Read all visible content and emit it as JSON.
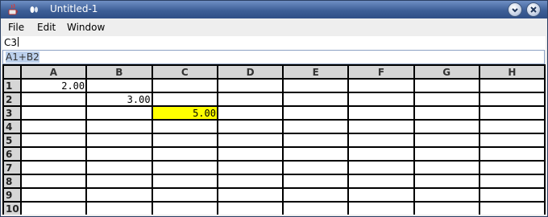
{
  "window": {
    "title": "Untitled-1",
    "icons": {
      "app": "java-cup-icon",
      "menu": "window-menu-icon",
      "minimize": "minimize-icon",
      "close": "close-icon"
    }
  },
  "menubar": {
    "items": [
      "File",
      "Edit",
      "Window"
    ]
  },
  "cell_reference": "C3",
  "formula": "A1+B2",
  "sheet": {
    "columns": [
      "A",
      "B",
      "C",
      "D",
      "E",
      "F",
      "G",
      "H"
    ],
    "rows": [
      {
        "label": "1",
        "cells": [
          "2.00",
          "",
          "",
          "",
          "",
          "",
          "",
          ""
        ]
      },
      {
        "label": "2",
        "cells": [
          "",
          "3.00",
          "",
          "",
          "",
          "",
          "",
          ""
        ]
      },
      {
        "label": "3",
        "cells": [
          "",
          "",
          "5.00",
          "",
          "",
          "",
          "",
          ""
        ]
      },
      {
        "label": "4",
        "cells": [
          "",
          "",
          "",
          "",
          "",
          "",
          "",
          ""
        ]
      },
      {
        "label": "5",
        "cells": [
          "",
          "",
          "",
          "",
          "",
          "",
          "",
          ""
        ]
      },
      {
        "label": "6",
        "cells": [
          "",
          "",
          "",
          "",
          "",
          "",
          "",
          ""
        ]
      },
      {
        "label": "7",
        "cells": [
          "",
          "",
          "",
          "",
          "",
          "",
          "",
          ""
        ]
      },
      {
        "label": "8",
        "cells": [
          "",
          "",
          "",
          "",
          "",
          "",
          "",
          ""
        ]
      },
      {
        "label": "9",
        "cells": [
          "",
          "",
          "",
          "",
          "",
          "",
          "",
          ""
        ]
      },
      {
        "label": "10",
        "cells": [
          "",
          "",
          "",
          "",
          "",
          "",
          "",
          ""
        ]
      }
    ],
    "selected_cell": "C3",
    "selected_color": "#ffff00"
  }
}
